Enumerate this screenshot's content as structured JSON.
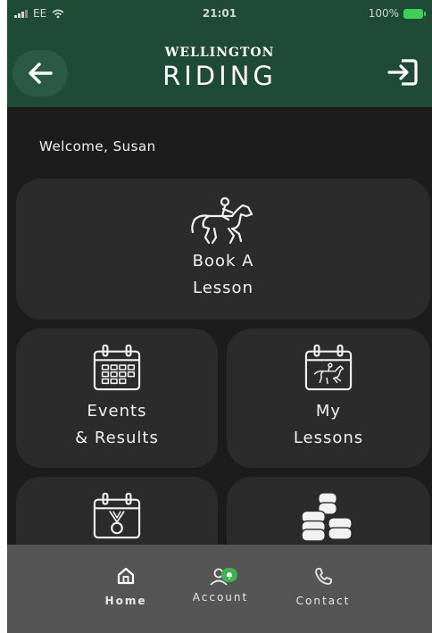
{
  "status_bar": {
    "carrier": "EE",
    "time": "21:01",
    "battery": "100%"
  },
  "header": {
    "brand_top": "WELLINGTON",
    "brand_main": "RIDING"
  },
  "welcome_text": "Welcome, Susan",
  "tiles": {
    "book_lesson": {
      "line1": "Book A",
      "line2": "Lesson",
      "icon": "horse-rider-icon"
    },
    "events_results": {
      "line1": "Events",
      "line2": "& Results",
      "icon": "calendar-grid-icon"
    },
    "my_lessons": {
      "line1": "My",
      "line2": "Lessons",
      "icon": "calendar-horse-icon"
    },
    "achievements": {
      "icon": "calendar-medal-icon"
    },
    "payments": {
      "icon": "coins-icon"
    }
  },
  "nav": {
    "home": "Home",
    "account": "Account",
    "contact": "Contact"
  },
  "colors": {
    "header_green": "#1f4a36",
    "content_bg": "#1c1c1c",
    "tile_bg": "#2b2b2b",
    "nav_bg": "#555555",
    "badge_green": "#3fb34f"
  }
}
